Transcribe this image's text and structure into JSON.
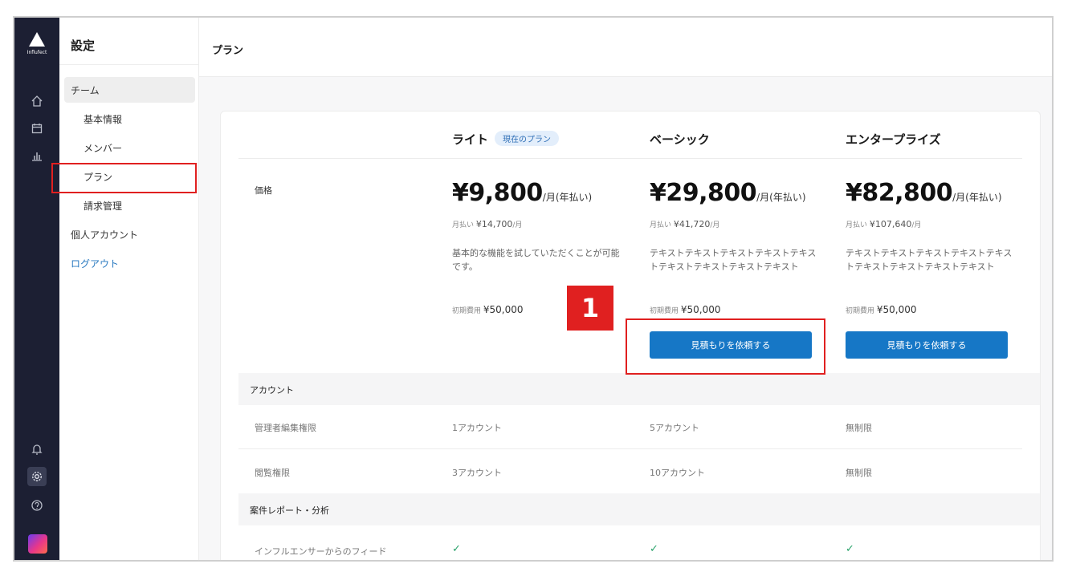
{
  "brand": {
    "logo_text": "Influfect"
  },
  "rail": {
    "icons": [
      "home-icon",
      "calendar-icon",
      "chart-icon",
      "bell-icon",
      "settings-icon",
      "help-icon"
    ]
  },
  "menu": {
    "title": "設定",
    "items": {
      "team": "チーム",
      "basic_info": "基本情報",
      "members": "メンバー",
      "plan": "プラン",
      "billing": "請求管理",
      "personal": "個人アカウント",
      "logout": "ログアウト"
    }
  },
  "header": {
    "title": "プラン"
  },
  "plans": [
    {
      "name": "ライト",
      "badge": "現在のプラン",
      "price": "¥9,800",
      "price_unit": "/月(年払い)",
      "monthly_label": "月払い",
      "monthly_price": "¥14,700",
      "monthly_unit": "/月",
      "description": "基本的な機能を試していただくことが可能です。",
      "initial_label": "初期費用",
      "initial_fee": "¥50,000",
      "cta": ""
    },
    {
      "name": "ベーシック",
      "badge": "",
      "price": "¥29,800",
      "price_unit": "/月(年払い)",
      "monthly_label": "月払い",
      "monthly_price": "¥41,720",
      "monthly_unit": "/月",
      "description": "テキストテキストテキストテキストテキストテキストテキストテキストテキスト",
      "initial_label": "初期費用",
      "initial_fee": "¥50,000",
      "cta": "見積もりを依頼する"
    },
    {
      "name": "エンタープライズ",
      "badge": "",
      "price": "¥82,800",
      "price_unit": "/月(年払い)",
      "monthly_label": "月払い",
      "monthly_price": "¥107,640",
      "monthly_unit": "/月",
      "description": "テキストテキストテキストテキストテキストテキストテキストテキストテキスト",
      "initial_label": "初期費用",
      "initial_fee": "¥50,000",
      "cta": "見積もりを依頼する"
    }
  ],
  "table": {
    "price_label": "価格",
    "section_account": "アカウント",
    "admin_edit": {
      "label": "管理者編集権限",
      "values": [
        "1アカウント",
        "5アカウント",
        "無制限"
      ]
    },
    "view": {
      "label": "閲覧権限",
      "values": [
        "3アカウント",
        "10アカウント",
        "無制限"
      ]
    },
    "section_report": "案件レポート・分析",
    "feedback": {
      "label": "インフルエンサーからのフィード",
      "values": [
        "✓",
        "✓",
        "✓"
      ]
    }
  },
  "annotation": {
    "step": "1"
  },
  "colors": {
    "accent": "#1677c6",
    "rail": "#1c1f33",
    "highlight": "#e02020",
    "check": "#2aa36b"
  }
}
